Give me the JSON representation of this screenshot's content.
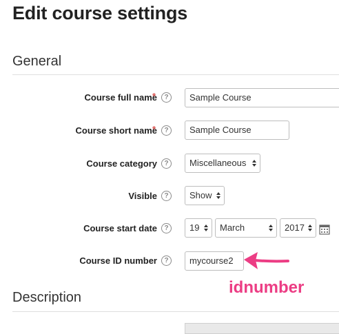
{
  "page": {
    "title": "Edit course settings"
  },
  "sections": {
    "general": "General",
    "description": "Description"
  },
  "fields": {
    "fullname": {
      "label": "Course full name",
      "value": "Sample Course",
      "required": "*"
    },
    "shortname": {
      "label": "Course short name",
      "value": "Sample Course",
      "required": "*"
    },
    "category": {
      "label": "Course category",
      "value": "Miscellaneous"
    },
    "visible": {
      "label": "Visible",
      "value": "Show"
    },
    "startdate": {
      "label": "Course start date",
      "day": "19",
      "month": "March",
      "year": "2017"
    },
    "idnumber": {
      "label": "Course ID number",
      "value": "mycourse2"
    }
  },
  "help_glyph": "?",
  "annotation": {
    "text": "idnumber",
    "color": "#ec3d84"
  },
  "colors": {
    "required": "#d9534f",
    "annotation": "#ec3d84"
  },
  "icons": {
    "help": "question-circle-icon",
    "calendar": "calendar-icon",
    "arrow": "arrow-left-icon"
  }
}
